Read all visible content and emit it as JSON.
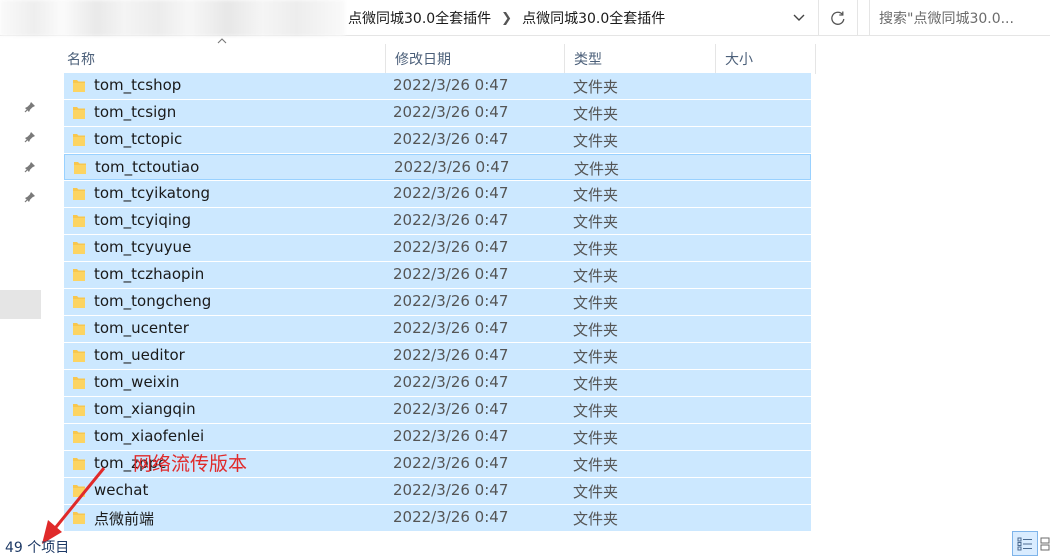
{
  "address": {
    "crumbs": [
      "点微同城30.0全套插件",
      "点微同城30.0全套插件"
    ],
    "search_placeholder": "搜索\"点微同城30.0..."
  },
  "columns": {
    "name": "名称",
    "date": "修改日期",
    "type": "类型",
    "size": "大小"
  },
  "rows": [
    {
      "name": "tom_tcshop",
      "date": "2022/3/26 0:47",
      "type": "文件夹"
    },
    {
      "name": "tom_tcsign",
      "date": "2022/3/26 0:47",
      "type": "文件夹"
    },
    {
      "name": "tom_tctopic",
      "date": "2022/3/26 0:47",
      "type": "文件夹"
    },
    {
      "name": "tom_tctoutiao",
      "date": "2022/3/26 0:47",
      "type": "文件夹"
    },
    {
      "name": "tom_tcyikatong",
      "date": "2022/3/26 0:47",
      "type": "文件夹"
    },
    {
      "name": "tom_tcyiqing",
      "date": "2022/3/26 0:47",
      "type": "文件夹"
    },
    {
      "name": "tom_tcyuyue",
      "date": "2022/3/26 0:47",
      "type": "文件夹"
    },
    {
      "name": "tom_tczhaopin",
      "date": "2022/3/26 0:47",
      "type": "文件夹"
    },
    {
      "name": "tom_tongcheng",
      "date": "2022/3/26 0:47",
      "type": "文件夹"
    },
    {
      "name": "tom_ucenter",
      "date": "2022/3/26 0:47",
      "type": "文件夹"
    },
    {
      "name": "tom_ueditor",
      "date": "2022/3/26 0:47",
      "type": "文件夹"
    },
    {
      "name": "tom_weixin",
      "date": "2022/3/26 0:47",
      "type": "文件夹"
    },
    {
      "name": "tom_xiangqin",
      "date": "2022/3/26 0:47",
      "type": "文件夹"
    },
    {
      "name": "tom_xiaofenlei",
      "date": "2022/3/26 0:47",
      "type": "文件夹"
    },
    {
      "name": "tom_zppc",
      "date": "2022/3/26 0:47",
      "type": "文件夹"
    },
    {
      "name": "wechat",
      "date": "2022/3/26 0:47",
      "type": "文件夹"
    },
    {
      "name": "点微前端",
      "date": "2022/3/26 0:47",
      "type": "文件夹"
    }
  ],
  "focused_row": 3,
  "watermark": "网络流传版本",
  "status": {
    "item_count": "49 个项目"
  },
  "colors": {
    "selection": "#cce8ff",
    "focus_border": "#99d1ff",
    "folder": "#f8c74e",
    "watermark": "#e02a2a"
  }
}
